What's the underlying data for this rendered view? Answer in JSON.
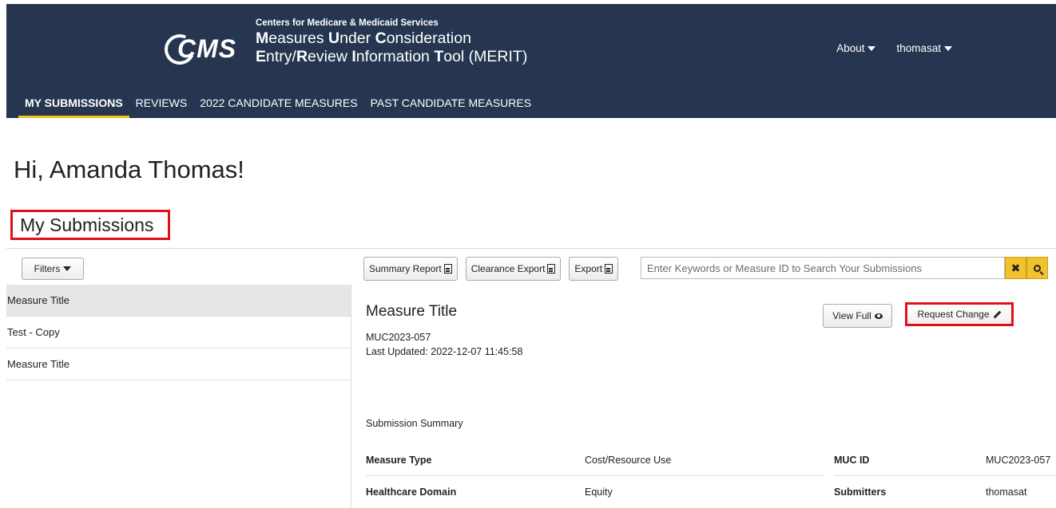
{
  "header": {
    "org": "Centers for Medicare & Medicaid Services",
    "logo_text": "CMS",
    "title_line1_initial": "M",
    "title_line1_rest": "easures ",
    "title_line1_u": "U",
    "title_line1_rest2": "nder ",
    "title_line1_c": "C",
    "title_line1_rest3": "onsideration",
    "title_line2_e": "E",
    "title_line2_rest": "ntry/",
    "title_line2_r": "R",
    "title_line2_rest2": "eview ",
    "title_line2_i": "I",
    "title_line2_rest3": "nformation ",
    "title_line2_t": "T",
    "title_line2_rest4": "ool (MERIT)",
    "about": "About",
    "user": "thomasat"
  },
  "nav": {
    "items": [
      "MY SUBMISSIONS",
      "REVIEWS",
      "2022 CANDIDATE MEASURES",
      "PAST CANDIDATE MEASURES"
    ]
  },
  "greeting": "Hi, Amanda Thomas!",
  "section_title": "My Submissions",
  "filters_label": "Filters",
  "list": [
    "Measure Title",
    "Test - Copy",
    "Measure Title"
  ],
  "toolbar": {
    "summary_report": "Summary Report",
    "clearance_export": "Clearance Export",
    "export": "Export",
    "search_placeholder": "Enter Keywords or Measure ID to Search Your Submissions",
    "clear_symbol": "✖"
  },
  "detail": {
    "title": "Measure Title",
    "muc_id": "MUC2023-057",
    "last_updated": "Last Updated: 2022-12-07 11:45:58",
    "view_full": "View Full",
    "request_change": "Request Change",
    "summary_heading": "Submission Summary",
    "rows": [
      {
        "label": "Measure Type",
        "value": "Cost/Resource Use",
        "label2": "MUC ID",
        "value2": "MUC2023-057"
      },
      {
        "label": "Healthcare Domain",
        "value": "Equity",
        "label2": "Submitters",
        "value2": "thomasat"
      }
    ]
  }
}
